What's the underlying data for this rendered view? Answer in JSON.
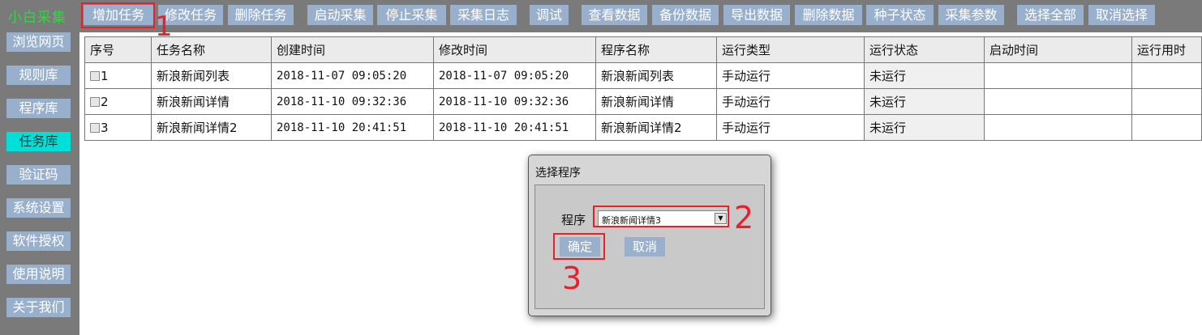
{
  "app": {
    "title": "小白采集"
  },
  "toolbar": [
    "增加任务",
    "修改任务",
    "删除任务",
    "启动采集",
    "停止采集",
    "采集日志",
    "调试",
    "查看数据",
    "备份数据",
    "导出数据",
    "删除数据",
    "种子状态",
    "采集参数",
    "选择全部",
    "取消选择"
  ],
  "sidebar": [
    {
      "label": "浏览网页",
      "active": false
    },
    {
      "label": "规则库",
      "active": false
    },
    {
      "label": "程序库",
      "active": false
    },
    {
      "label": "任务库",
      "active": true
    },
    {
      "label": "验证码",
      "active": false
    },
    {
      "label": "系统设置",
      "active": false
    },
    {
      "label": "软件授权",
      "active": false
    },
    {
      "label": "使用说明",
      "active": false
    },
    {
      "label": "关于我们",
      "active": false
    }
  ],
  "table": {
    "columns": [
      "序号",
      "任务名称",
      "创建时间",
      "修改时间",
      "程序名称",
      "运行类型",
      "运行状态",
      "启动时间",
      "运行用时"
    ],
    "rows": [
      [
        "1",
        "新浪新闻列表",
        "2018-11-07 09:05:20",
        "2018-11-07 09:05:20",
        "新浪新闻列表",
        "手动运行",
        "未运行",
        "",
        ""
      ],
      [
        "2",
        "新浪新闻详情",
        "2018-11-10 09:32:36",
        "2018-11-10 09:32:36",
        "新浪新闻详情",
        "手动运行",
        "未运行",
        "",
        ""
      ],
      [
        "3",
        "新浪新闻详情2",
        "2018-11-10 20:41:51",
        "2018-11-10 20:41:51",
        "新浪新闻详情2",
        "手动运行",
        "未运行",
        "",
        ""
      ]
    ]
  },
  "dialog": {
    "title": "选择程序",
    "program_label": "程序",
    "selected_program": "新浪新闻详情3",
    "confirm_label": "确定",
    "cancel_label": "取消"
  },
  "annotations": {
    "step1": "1",
    "step2": "2",
    "step3": "3",
    "color": "#e8202a"
  },
  "colors": {
    "button": "#99b0cc",
    "active": "#00e0d8",
    "title": "#22e038",
    "chrome": "#7a7a7a"
  }
}
